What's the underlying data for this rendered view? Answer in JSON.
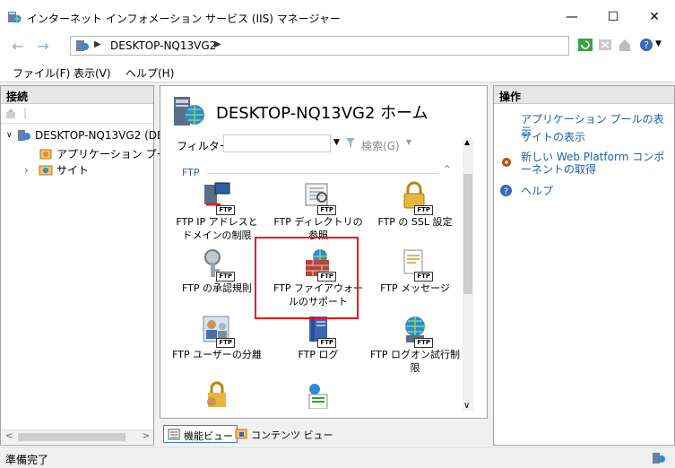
{
  "window": {
    "title": "インターネット インフォメーション サービス (IIS) マネージャー",
    "minimize": "—",
    "maximize": "☐",
    "close": "✕"
  },
  "address": {
    "crumb": "DESKTOP-NQ13VG2",
    "sep1": "▶",
    "sep2": "▶",
    "back": "←",
    "forward": "→"
  },
  "menu": [
    "ファイル(F)",
    "表示(V)",
    "ヘルプ(H)"
  ],
  "connections": {
    "header": "接続",
    "tree": [
      {
        "label": "DESKTOP-NQ13VG2 (DE",
        "expander": "∨",
        "icon": "server-icon"
      },
      {
        "label": "アプリケーション プール",
        "expander": "",
        "icon": "app-pool-icon"
      },
      {
        "label": "サイト",
        "expander": "›",
        "icon": "sites-icon"
      }
    ]
  },
  "home": {
    "title": "DESKTOP-NQ13VG2 ホーム",
    "filter_label": "フィルター:",
    "filter_value": "",
    "search_label": "検索(G)",
    "group_label": "FTP",
    "features": [
      {
        "label": "FTP IP アドレスとドメインの制限",
        "icon": "ftp-ip-restrictions-icon"
      },
      {
        "label": "FTP ディレクトリの参照",
        "icon": "ftp-directory-browsing-icon"
      },
      {
        "label": "FTP の SSL 設定",
        "icon": "ftp-ssl-icon"
      },
      {
        "label": "FTP の承認規則",
        "icon": "ftp-authorization-icon"
      },
      {
        "label": "FTP ファイアウォールのサポート",
        "icon": "ftp-firewall-icon"
      },
      {
        "label": "FTP メッセージ",
        "icon": "ftp-messages-icon"
      },
      {
        "label": "FTP ユーザーの分離",
        "icon": "ftp-user-isolation-icon"
      },
      {
        "label": "FTP ログ",
        "icon": "ftp-logging-icon"
      },
      {
        "label": "FTP ログオン試行制限",
        "icon": "ftp-logon-attempt-icon"
      }
    ],
    "badge": "FTP"
  },
  "viewtabs": {
    "features": "機能ビュー",
    "content": "コンテンツ ビュー"
  },
  "actions": {
    "header": "操作",
    "items": [
      {
        "label": "アプリケーション プールの表示"
      },
      {
        "label": "サイトの表示"
      },
      {
        "label": "新しい Web Platform コンポーネントの取得"
      },
      {
        "label": "ヘルプ"
      }
    ]
  },
  "status": {
    "text": "準備完了"
  },
  "colors": {
    "link": "#1a5fb4",
    "highlight": "#e11111",
    "group_header": "#3a5f9e"
  }
}
